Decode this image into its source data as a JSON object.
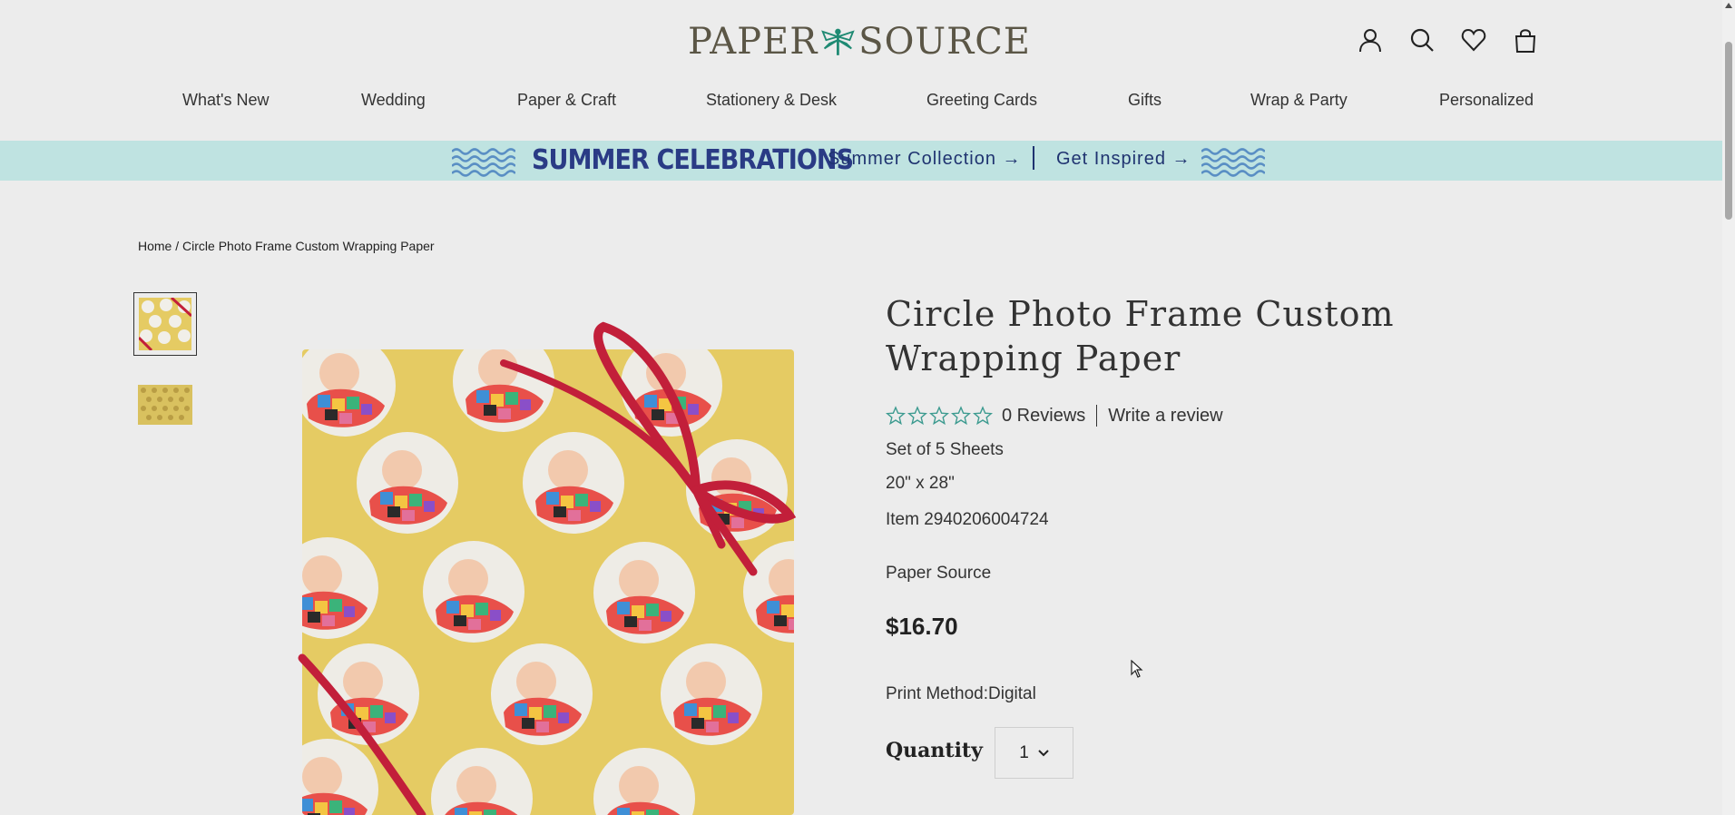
{
  "header": {
    "logo": {
      "left": "PAPER",
      "right": "SOURCE"
    },
    "icons": [
      "account-icon",
      "search-icon",
      "heart-icon",
      "bag-icon"
    ]
  },
  "nav": {
    "items": [
      "What's New",
      "Wedding",
      "Paper & Craft",
      "Stationery & Desk",
      "Greeting Cards",
      "Gifts",
      "Wrap & Party",
      "Personalized"
    ]
  },
  "banner": {
    "title": "SUMMER CELEBRATIONS",
    "link1": "Summer Collection →",
    "link2": "Get Inspired →",
    "bg_color": "#bfe3e1",
    "accent_color": "#2a3b85"
  },
  "breadcrumb": {
    "home": "Home",
    "separator": "/",
    "current": "Circle Photo Frame Custom Wrapping Paper"
  },
  "product": {
    "title": "Circle Photo Frame Custom Wrapping Paper",
    "reviews": "0 Reviews",
    "write_review": "Write a review",
    "rating": 0,
    "sheets": "Set of 5 Sheets",
    "size": "20\" x 28\"",
    "item": "Item 2940206004724",
    "brand": "Paper Source",
    "price": "$16.70",
    "print_method": "Print Method:Digital",
    "quantity_label": "Quantity",
    "quantity_value": "1",
    "star_color": "#3d9b90",
    "paper_color": "#e5cb63",
    "ribbon_color": "#c21f3a"
  }
}
